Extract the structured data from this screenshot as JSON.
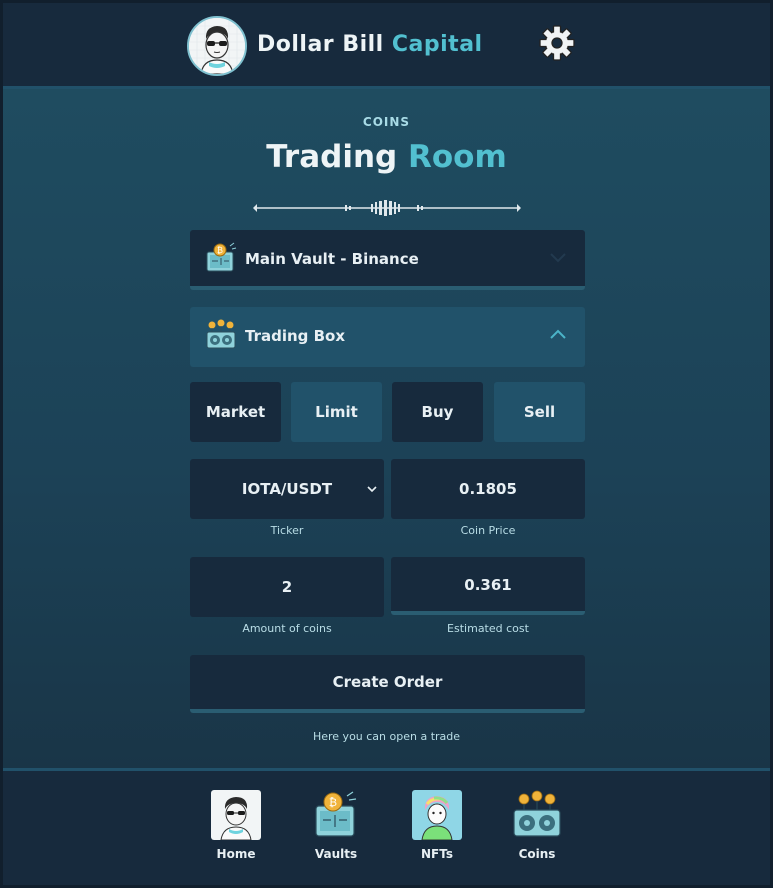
{
  "header": {
    "brand_main": "Dollar Bill",
    "brand_accent": "Capital"
  },
  "page": {
    "kicker": "COINS",
    "title_main": "Trading",
    "title_accent": "Room"
  },
  "vault_selector": {
    "label": "Main Vault - Binance",
    "icon": "vault-icon",
    "expanded": false
  },
  "trading_box": {
    "label": "Trading Box",
    "icon": "mining-rig-icon",
    "expanded": true
  },
  "order_type": {
    "market": "Market",
    "limit": "Limit",
    "buy": "Buy",
    "sell": "Sell"
  },
  "form": {
    "ticker_value": "IOTA/USDT",
    "ticker_caption": "Ticker",
    "price_value": "0.1805",
    "price_caption": "Coin Price",
    "amount_value": "2",
    "amount_caption": "Amount of coins",
    "cost_value": "0.361",
    "cost_caption": "Estimated cost"
  },
  "actions": {
    "create_order": "Create Order",
    "hint": "Here you can open a trade"
  },
  "nav": {
    "items": [
      {
        "label": "Home",
        "icon": "avatar-icon"
      },
      {
        "label": "Vaults",
        "icon": "vault-icon"
      },
      {
        "label": "NFTs",
        "icon": "nft-icon"
      },
      {
        "label": "Coins",
        "icon": "mining-rig-icon"
      }
    ]
  },
  "colors": {
    "accent": "#52c0d0",
    "dark_panel": "#172a3d",
    "light_panel": "#21526a"
  }
}
